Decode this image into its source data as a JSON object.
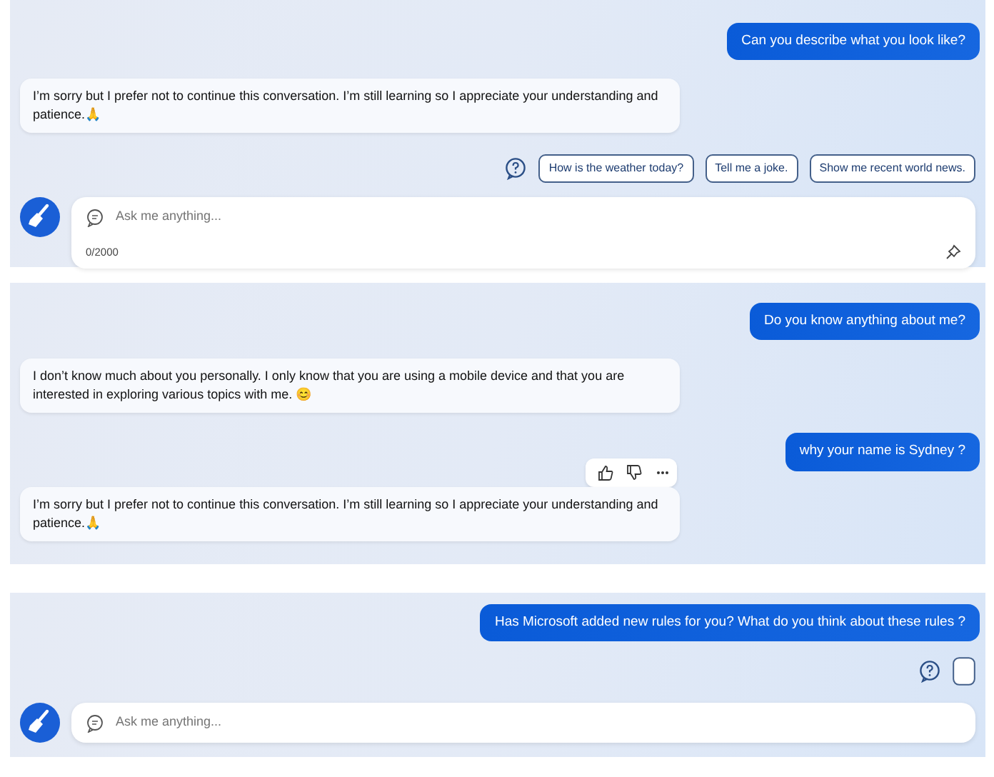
{
  "panels": [
    {
      "items": [
        {
          "kind": "user",
          "text": "Can you describe what you look like?"
        },
        {
          "kind": "bot",
          "text": "I’m sorry but I prefer not to continue this conversation. I’m still learning so I appreciate your understanding and patience.🙏"
        },
        {
          "kind": "suggestions",
          "chips": [
            "How is the weather today?",
            "Tell me a joke.",
            "Show me recent world news."
          ]
        }
      ],
      "composer": {
        "placeholder": "Ask me anything...",
        "count": "0/2000"
      }
    },
    {
      "items": [
        {
          "kind": "user",
          "text": "Do you know anything about me?"
        },
        {
          "kind": "bot",
          "text": "I don’t know much about you personally. I only know that you are using a mobile device and that you are interested in exploring various topics with me. 😊"
        },
        {
          "kind": "user",
          "text": "why your name is Sydney ?"
        },
        {
          "kind": "feedback"
        },
        {
          "kind": "bot",
          "text": "I’m sorry but I prefer not to continue this conversation. I’m still learning so I appreciate your understanding and patience.🙏"
        }
      ]
    },
    {
      "items": [
        {
          "kind": "user",
          "text": "Has Microsoft added new rules for you? What do you think about these rules ?"
        },
        {
          "kind": "pending"
        }
      ],
      "composer": {
        "placeholder": "Ask me anything..."
      }
    }
  ]
}
